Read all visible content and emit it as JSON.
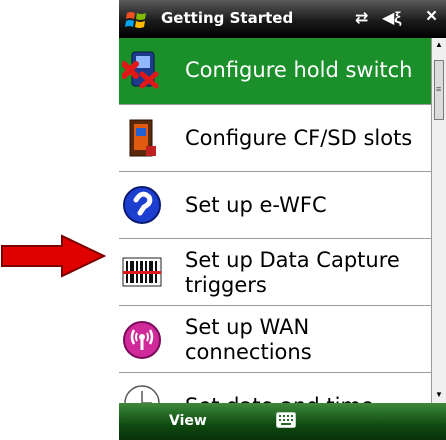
{
  "titlebar": {
    "title": "Getting Started",
    "close_label": "×",
    "icons": [
      "windows-start-icon",
      "connectivity-icon",
      "volume-icon"
    ]
  },
  "items": [
    {
      "label": "Configure hold switch",
      "icon": "hold-switch-icon",
      "selected": true
    },
    {
      "label": "Configure CF/SD slots",
      "icon": "cf-sd-card-icon",
      "selected": false
    },
    {
      "label": "Set up e-WFC",
      "icon": "e-wfc-icon",
      "selected": false
    },
    {
      "label_line1": "Set up Data Capture",
      "label_line2": "triggers",
      "icon": "barcode-scanner-icon",
      "selected": false
    },
    {
      "label_line1": "Set up WAN",
      "label_line2": "connections",
      "icon": "wan-wireless-icon",
      "selected": false
    },
    {
      "label": "Set date and time",
      "icon": "clock-icon",
      "selected": false
    }
  ],
  "menubar": {
    "left_softkey": "View",
    "input_icon": "keyboard-icon"
  },
  "colors": {
    "selected_bg": "#1a8f2a",
    "titlebar_bg": "#000000",
    "menubar_bg": "#0f4a10",
    "arrow": "#e00000"
  }
}
